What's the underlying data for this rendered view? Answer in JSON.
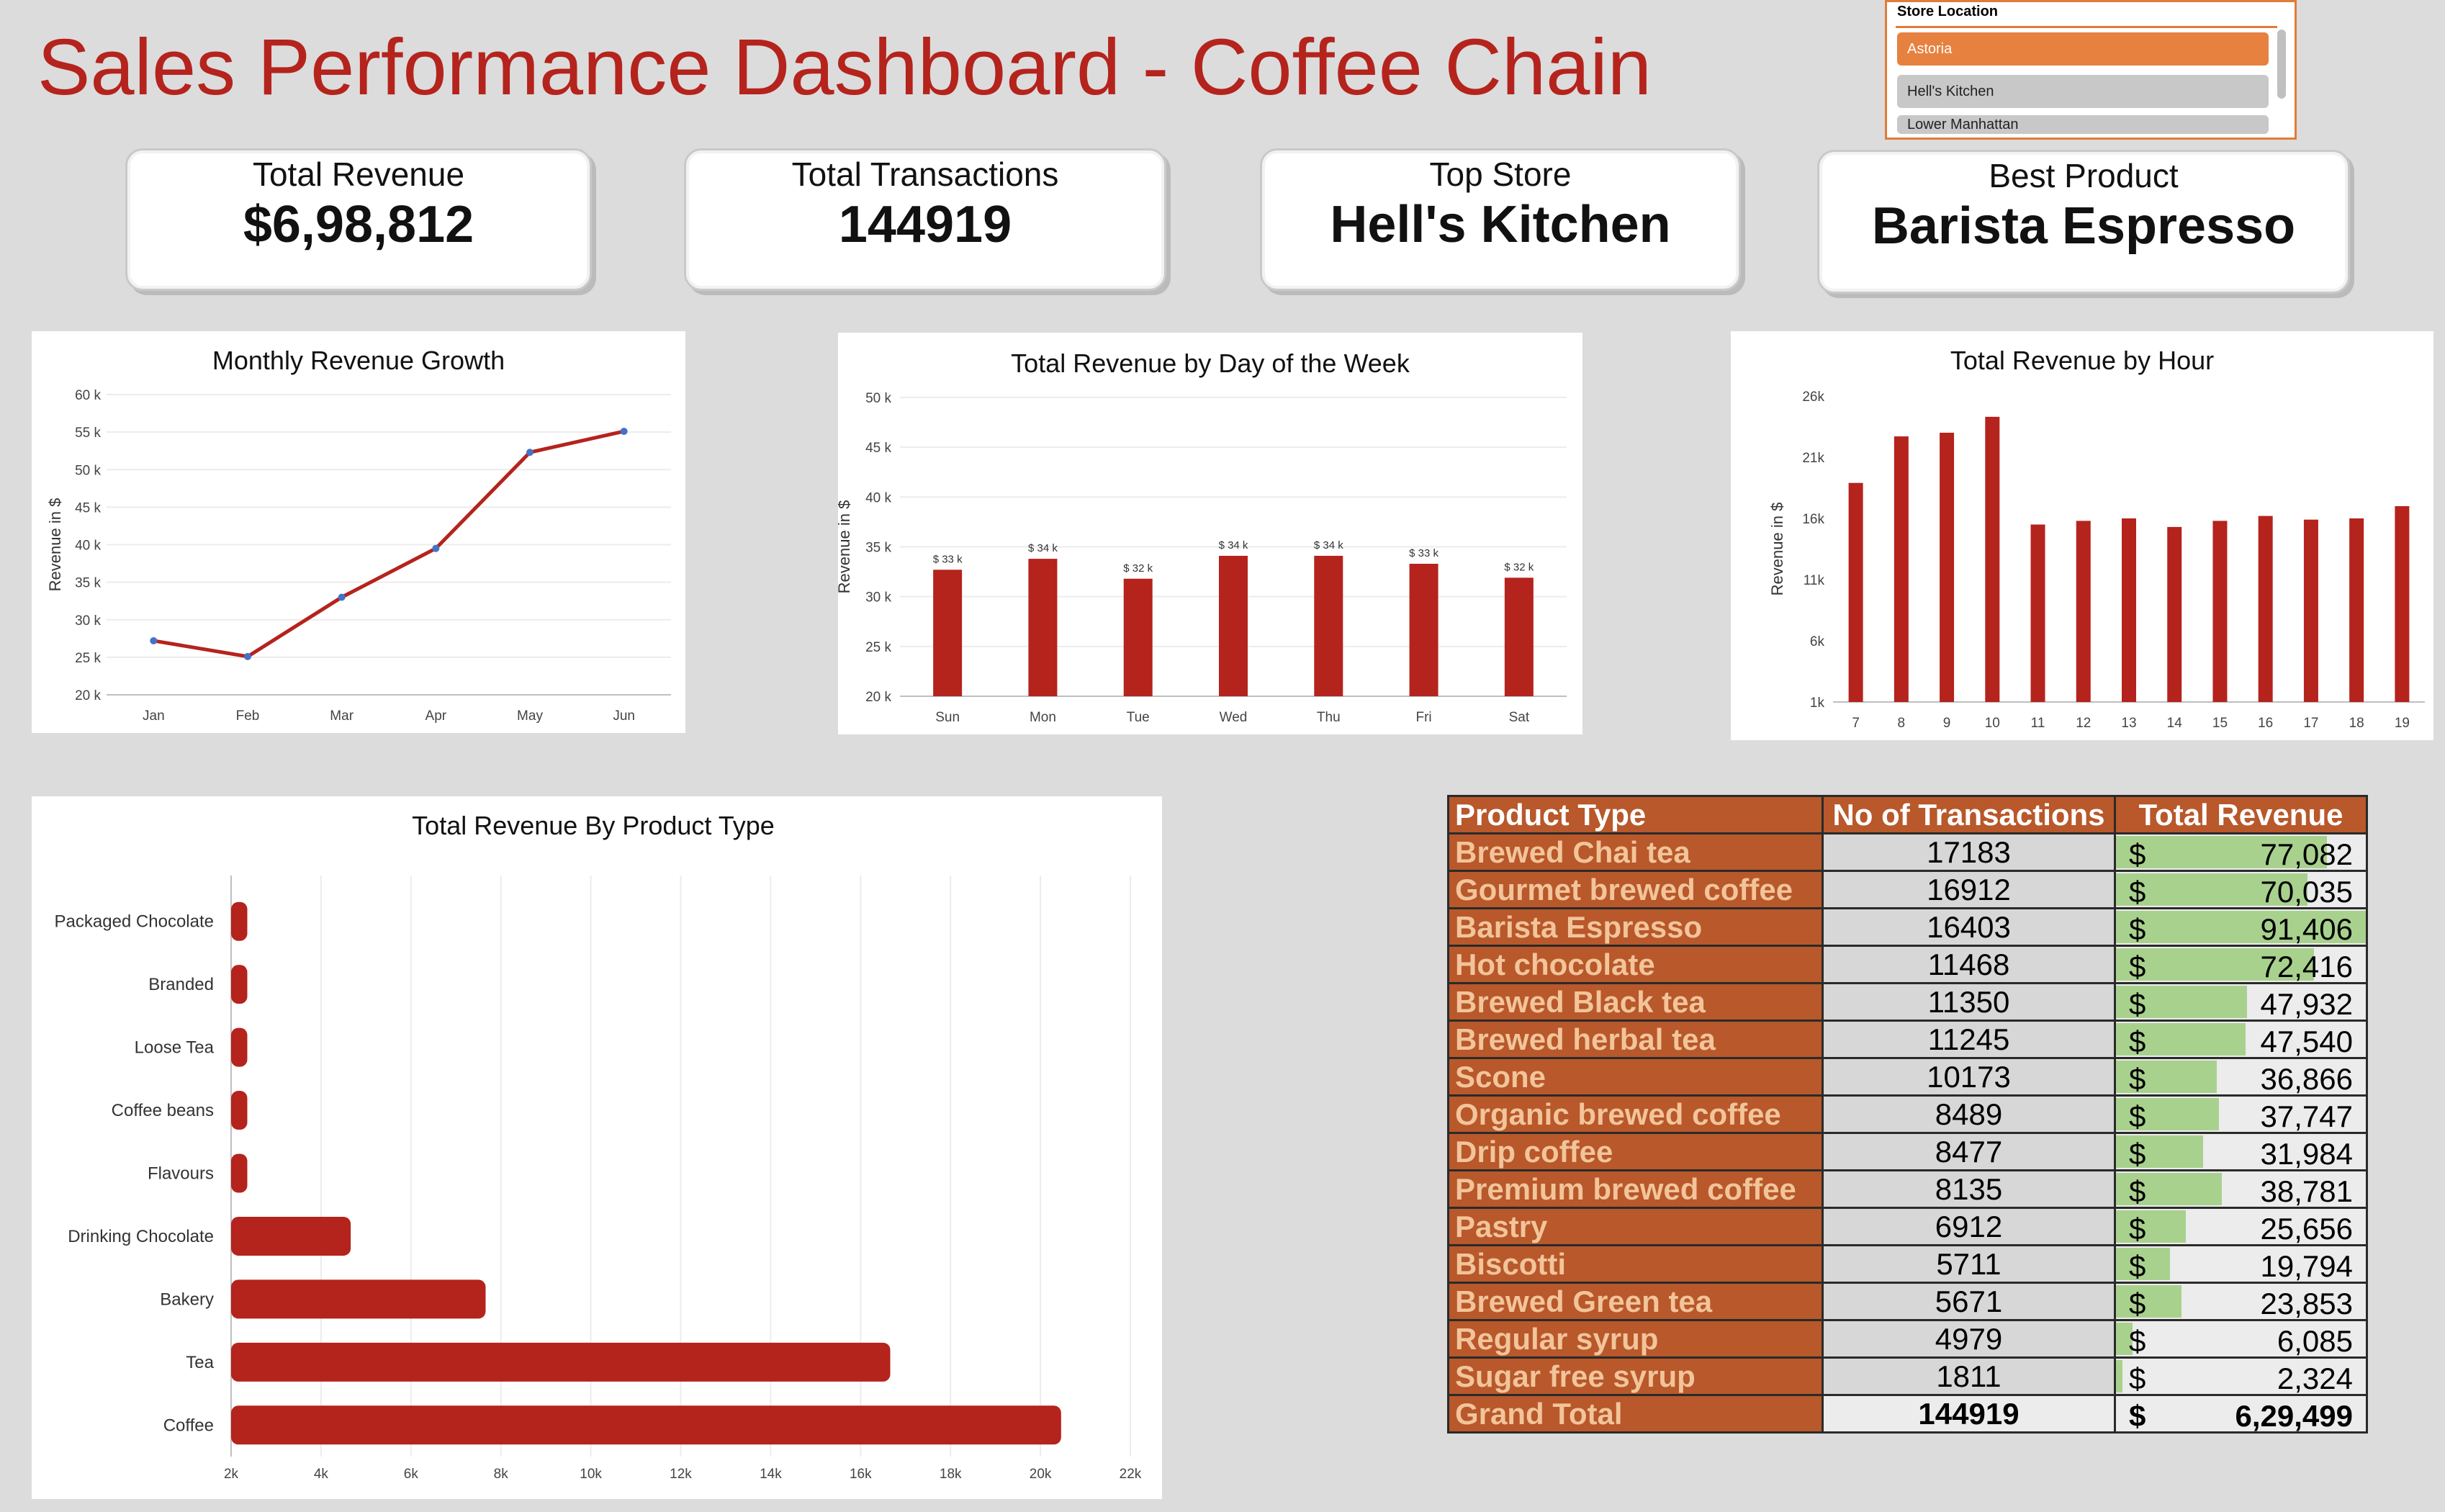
{
  "title": "Sales Performance Dashboard - Coffee Chain",
  "slicer": {
    "header": "Store Location",
    "items": [
      {
        "label": "Astoria",
        "selected": true
      },
      {
        "label": "Hell's Kitchen",
        "selected": false
      },
      {
        "label": "Lower Manhattan",
        "selected": false
      }
    ]
  },
  "kpis": [
    {
      "label": "Total Revenue",
      "value": "$6,98,812"
    },
    {
      "label": "Total Transactions",
      "value": "144919"
    },
    {
      "label": "Top Store",
      "value": "Hell's Kitchen"
    },
    {
      "label": "Best Product",
      "value": "Barista Espresso"
    }
  ],
  "chart_data": [
    {
      "id": "monthly",
      "type": "line",
      "title": "Monthly Revenue Growth",
      "ylabel": "Revenue in $",
      "categories": [
        "Jan",
        "Feb",
        "Mar",
        "Apr",
        "May",
        "Jun"
      ],
      "values": [
        27200,
        25100,
        33000,
        39500,
        52300,
        55100
      ],
      "ylim": [
        20000,
        60000
      ],
      "yticks": [
        "20 k",
        "25 k",
        "30 k",
        "35 k",
        "40 k",
        "45 k",
        "50 k",
        "55 k",
        "60 k"
      ],
      "grid": true,
      "color": "#b5231d",
      "marker_color": "#4472c4"
    },
    {
      "id": "weekday",
      "type": "bar",
      "title": "Total Revenue by Day of the Week",
      "ylabel": "Revenue in $",
      "categories": [
        "Sun",
        "Mon",
        "Tue",
        "Wed",
        "Thu",
        "Fri",
        "Sat"
      ],
      "values": [
        32700,
        33800,
        31800,
        34100,
        34100,
        33300,
        31900
      ],
      "data_labels": [
        "$ 33 k",
        "$ 34 k",
        "$ 32 k",
        "$ 34 k",
        "$ 34 k",
        "$ 33 k",
        "$ 32 k"
      ],
      "ylim": [
        20000,
        50000
      ],
      "yticks": [
        "20 k",
        "25 k",
        "30 k",
        "35 k",
        "40 k",
        "45 k",
        "50 k"
      ],
      "grid": true,
      "color": "#b5231d"
    },
    {
      "id": "hourly",
      "type": "bar",
      "title": "Total Revenue by Hour",
      "ylabel": "Revenue in $",
      "categories": [
        "7",
        "8",
        "9",
        "10",
        "11",
        "12",
        "13",
        "14",
        "15",
        "16",
        "17",
        "18",
        "19"
      ],
      "values": [
        18900,
        22700,
        23000,
        24300,
        15500,
        15800,
        16000,
        15300,
        15800,
        16200,
        15900,
        16000,
        17000
      ],
      "ylim": [
        1000,
        26000
      ],
      "yticks": [
        "1k",
        "6k",
        "11k",
        "16k",
        "21k",
        "26k"
      ],
      "grid": false,
      "color": "#b5231d"
    },
    {
      "id": "producttype",
      "type": "bar",
      "orientation": "horizontal",
      "title": "Total Revenue By Product Type",
      "categories": [
        "Packaged Chocolate",
        "Branded",
        "Loose Tea",
        "Coffee beans",
        "Flavours",
        "Drinking Chocolate",
        "Bakery",
        "Tea",
        "Coffee"
      ],
      "values": [
        2200,
        2200,
        2200,
        2200,
        2200,
        4500,
        7500,
        16500,
        20300
      ],
      "xlim": [
        2000,
        22000
      ],
      "xticks": [
        "2k",
        "4k",
        "6k",
        "8k",
        "10k",
        "12k",
        "14k",
        "16k",
        "18k",
        "20k",
        "22k"
      ],
      "grid": true,
      "color": "#b5231d"
    },
    {
      "id": "pivot",
      "type": "table",
      "headers": [
        "Product Type",
        "No of Transactions",
        "Total Revenue"
      ],
      "rows": [
        {
          "name": "Brewed Chai tea",
          "tx": "17183",
          "rev": "77,082",
          "revnum": 77082
        },
        {
          "name": "Gourmet brewed coffee",
          "tx": "16912",
          "rev": "70,035",
          "revnum": 70035
        },
        {
          "name": "Barista Espresso",
          "tx": "16403",
          "rev": "91,406",
          "revnum": 91406
        },
        {
          "name": "Hot chocolate",
          "tx": "11468",
          "rev": "72,416",
          "revnum": 72416
        },
        {
          "name": "Brewed Black tea",
          "tx": "11350",
          "rev": "47,932",
          "revnum": 47932
        },
        {
          "name": "Brewed herbal tea",
          "tx": "11245",
          "rev": "47,540",
          "revnum": 47540
        },
        {
          "name": "Scone",
          "tx": "10173",
          "rev": "36,866",
          "revnum": 36866
        },
        {
          "name": "Organic brewed coffee",
          "tx": "8489",
          "rev": "37,747",
          "revnum": 37747
        },
        {
          "name": "Drip coffee",
          "tx": "8477",
          "rev": "31,984",
          "revnum": 31984
        },
        {
          "name": "Premium brewed coffee",
          "tx": "8135",
          "rev": "38,781",
          "revnum": 38781
        },
        {
          "name": "Pastry",
          "tx": "6912",
          "rev": "25,656",
          "revnum": 25656
        },
        {
          "name": "Biscotti",
          "tx": "5711",
          "rev": "19,794",
          "revnum": 19794
        },
        {
          "name": "Brewed Green tea",
          "tx": "5671",
          "rev": "23,853",
          "revnum": 23853
        },
        {
          "name": "Regular syrup",
          "tx": "4979",
          "rev": "6,085",
          "revnum": 6085
        },
        {
          "name": "Sugar free syrup",
          "tx": "1811",
          "rev": "2,324",
          "revnum": 2324
        }
      ],
      "total": {
        "name": "Grand Total",
        "tx": "144919",
        "rev": "6,29,499"
      },
      "currency": "$",
      "databar_color": "#a9d18e"
    }
  ]
}
